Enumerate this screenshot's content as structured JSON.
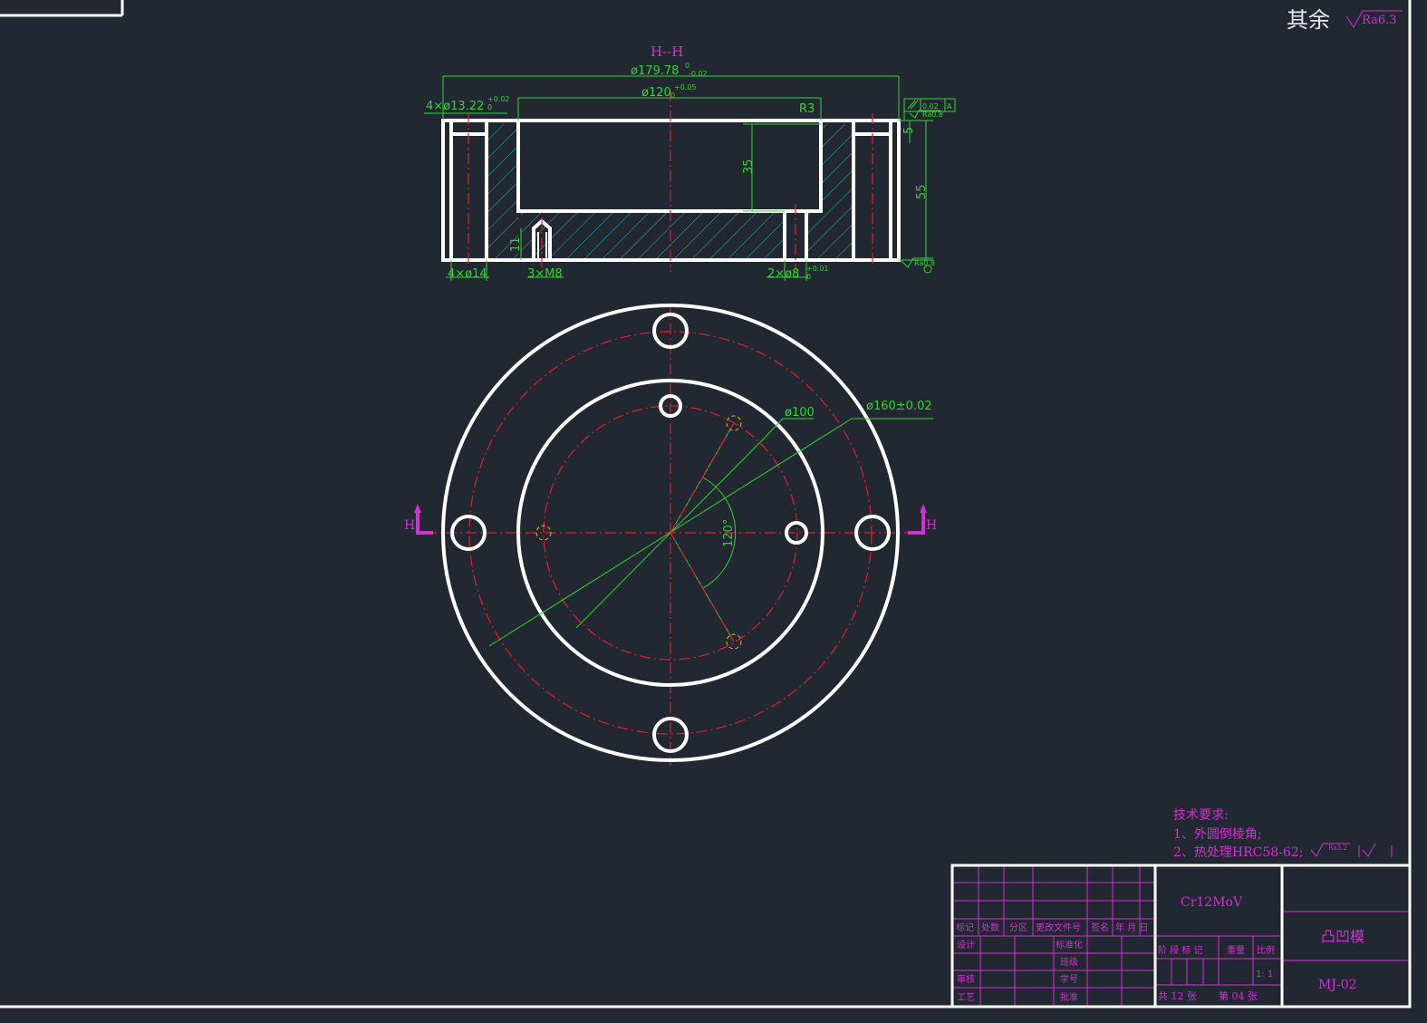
{
  "surface_finish": {
    "note": "其余",
    "ra": "Ra6.3"
  },
  "section_title": "H--H",
  "dims": {
    "d_outer": "ø179.78",
    "d_outer_tol_upper": "0",
    "d_outer_tol_lower": "-0.02",
    "d_pocket": "ø120",
    "d_pocket_tol_lower": "0",
    "d_pocket_tol_upper": "+0.05",
    "holes_top": "4×ø13.22",
    "holes_top_tol_upper": "+0.02",
    "holes_top_tol_lower": "0",
    "radius": "R3",
    "pocket_depth": "35",
    "height": "55",
    "top_step": "5",
    "thread_depth": "11",
    "holes_bottom": "4×ø14",
    "thread": "3×M8",
    "pins": "2×ø8",
    "pins_tol": "+0.01",
    "pins_tol_lower": "0",
    "flatness_value": "0.02",
    "datum": "A",
    "ra_small": "Ra0.8",
    "ra_bottom": "Ra0.8",
    "d_bolt_circle": "ø160±0.02",
    "d_inner_circle": "ø100",
    "angle": "120°"
  },
  "section_markers": {
    "left": "H",
    "right": "H"
  },
  "tech_req": {
    "title": "技术要求:",
    "item1": "1、外圆倒棱角;",
    "item2": "2、热处理HRC58-62;",
    "ra": "Ra3.2"
  },
  "title_block": {
    "material": "Cr12MoV",
    "part_name": "凸凹模",
    "drawing_no": "MJ-02",
    "header_labels": [
      "标记",
      "处数",
      "分区",
      "更改文件号",
      "签名",
      "年 月 日"
    ],
    "left_rows": [
      "设计",
      "审核",
      "工艺"
    ],
    "mid_rows": [
      "标准化",
      "班级",
      "学号",
      "批准"
    ],
    "stage_label": "阶 段 标 记",
    "weight_label": "重量",
    "scale_label": "比例",
    "scale": "1:  1",
    "sheets_total": "共 12 张",
    "sheet_no": "第 04 张"
  },
  "colors": {
    "background": "#222831",
    "outline": "#ffffff",
    "centerline": "#e0202a",
    "dimension": "#2fd62f",
    "annotation": "#d42fd4",
    "hatch": "#2bb3b8"
  }
}
